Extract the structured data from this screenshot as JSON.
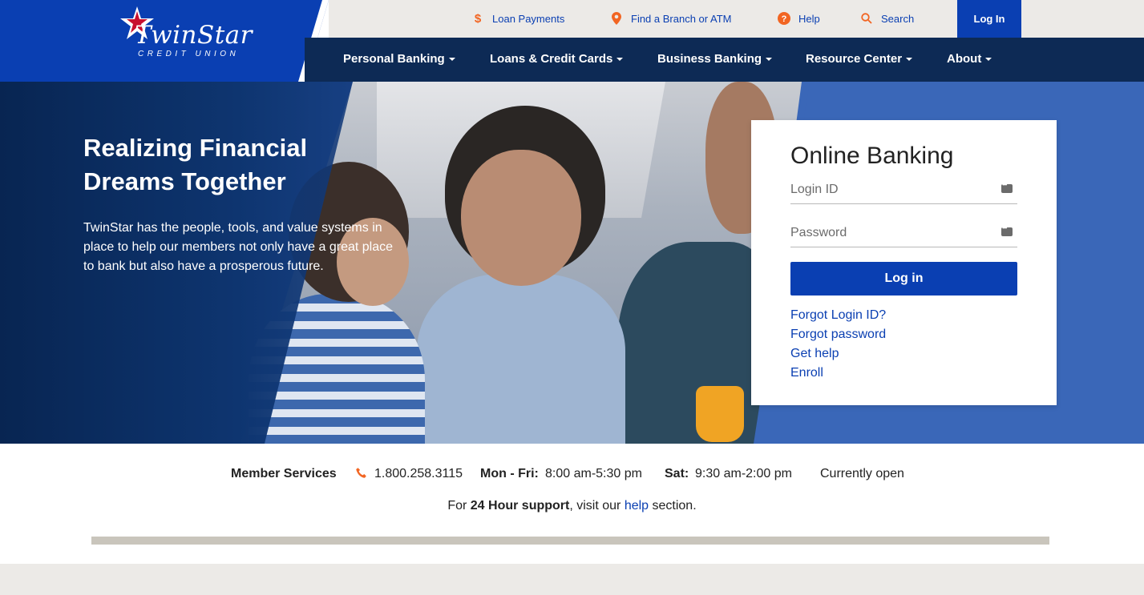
{
  "brand": {
    "name": "TwinStar",
    "sub": "CREDIT UNION",
    "color": "#0a3fb2",
    "accent": "#f26522"
  },
  "utility": {
    "items": [
      {
        "label": "Loan Payments",
        "icon": "dollar-icon"
      },
      {
        "label": "Find a Branch or ATM",
        "icon": "location-pin-icon"
      },
      {
        "label": "Help",
        "icon": "question-icon"
      },
      {
        "label": "Search",
        "icon": "search-icon"
      }
    ],
    "login": "Log In"
  },
  "nav": {
    "items": [
      {
        "label": "Personal Banking"
      },
      {
        "label": "Loans & Credit Cards"
      },
      {
        "label": "Business Banking"
      },
      {
        "label": "Resource Center"
      },
      {
        "label": "About"
      }
    ]
  },
  "hero": {
    "title": "Realizing Financial Dreams Together",
    "text": "TwinStar has the people, tools, and value systems in place to help our members not only have a great place to bank but also have a prosperous future."
  },
  "login_card": {
    "title": "Online Banking",
    "login_id_placeholder": "Login ID",
    "password_placeholder": "Password",
    "button": "Log in",
    "links": [
      "Forgot Login ID?",
      "Forgot password",
      "Get help",
      "Enroll"
    ]
  },
  "services": {
    "label": "Member Services",
    "phone": "1.800.258.3115",
    "weekday_label": "Mon - Fri:",
    "weekday_hours": "8:00 am-5:30 pm",
    "sat_label": "Sat:",
    "sat_hours": "9:30 am-2:00 pm",
    "status": "Currently open",
    "support_prefix": "For ",
    "support_bold": "24 Hour support",
    "support_mid": ", visit our ",
    "support_link": "help",
    "support_suffix": " section."
  }
}
